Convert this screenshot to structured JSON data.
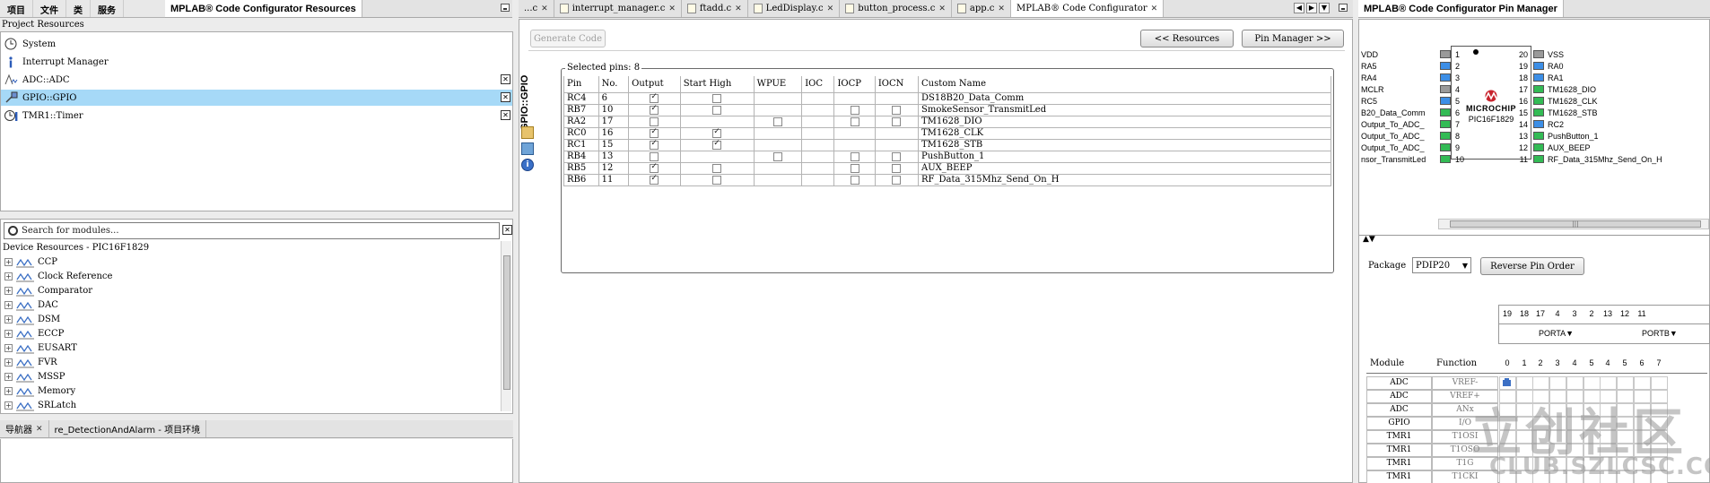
{
  "menu": [
    "项目",
    "文件",
    "类",
    "服务"
  ],
  "left_top": {
    "tab": "MPLAB® Code Configurator Resources",
    "section": "Project Resources",
    "items": [
      {
        "label": "System",
        "icon": "clock-icon"
      },
      {
        "label": "Interrupt Manager",
        "icon": "info-icon"
      },
      {
        "label": "ADC::ADC",
        "icon": "adc-icon"
      },
      {
        "label": "GPIO::GPIO",
        "icon": "pin-icon"
      },
      {
        "label": "TMR1::Timer",
        "icon": "timer-icon"
      }
    ]
  },
  "left_mid": {
    "search_placeholder": "Search for modules...",
    "device_title": "Device Resources - PIC16F1829",
    "items": [
      "CCP",
      "Clock Reference",
      "Comparator",
      "DAC",
      "DSM",
      "ECCP",
      "EUSART",
      "FVR",
      "MSSP",
      "Memory",
      "SRLatch"
    ]
  },
  "left_bottom": {
    "tab1": "导航器",
    "tab2": "re_DetectionAndAlarm - 项目环境"
  },
  "editor_tabs": [
    "...c",
    "interrupt_manager.c",
    "ftadd.c",
    "LedDisplay.c",
    "button_process.c",
    "app.c",
    "MPLAB® Code Configurator"
  ],
  "center": {
    "generate_label": "Generate Code",
    "resources_label": "<< Resources",
    "pin_manager_label": "Pin Manager >>",
    "side_title": "GPIO::GPIO",
    "selected_pins": "Selected pins: 8",
    "columns": [
      "Pin",
      "No.",
      "Output",
      "Start High",
      "WPUE",
      "IOC",
      "IOCP",
      "IOCN",
      "Custom Name"
    ],
    "rows": [
      {
        "pin": "RC4",
        "no": "6",
        "output": true,
        "start_high": false,
        "wpue": null,
        "iocp": null,
        "iocn": null,
        "name": "DS18B20_Data_Comm"
      },
      {
        "pin": "RB7",
        "no": "10",
        "output": true,
        "start_high": false,
        "wpue": null,
        "iocp": false,
        "iocn": false,
        "name": "SmokeSensor_TransmitLed"
      },
      {
        "pin": "RA2",
        "no": "17",
        "output": false,
        "start_high": null,
        "wpue": false,
        "iocp": false,
        "iocn": false,
        "name": "TM1628_DIO"
      },
      {
        "pin": "RC0",
        "no": "16",
        "output": true,
        "start_high": true,
        "wpue": null,
        "iocp": null,
        "iocn": null,
        "name": "TM1628_CLK"
      },
      {
        "pin": "RC1",
        "no": "15",
        "output": true,
        "start_high": true,
        "wpue": null,
        "iocp": null,
        "iocn": null,
        "name": "TM1628_STB"
      },
      {
        "pin": "RB4",
        "no": "13",
        "output": false,
        "start_high": null,
        "wpue": false,
        "iocp": false,
        "iocn": false,
        "name": "PushButton_1"
      },
      {
        "pin": "RB5",
        "no": "12",
        "output": true,
        "start_high": false,
        "wpue": null,
        "iocp": false,
        "iocn": false,
        "name": "AUX_BEEP"
      },
      {
        "pin": "RB6",
        "no": "11",
        "output": true,
        "start_high": false,
        "wpue": null,
        "iocp": false,
        "iocn": false,
        "name": "RF_Data_315Mhz_Send_On_H"
      }
    ]
  },
  "right": {
    "tab": "MPLAB® Code Configurator Pin Manager",
    "chip_brand": "MICROCHIP",
    "chip_name": "PIC16F1829",
    "left_pins": [
      {
        "label": "VDD",
        "num": "1",
        "color": "#9a9a9a"
      },
      {
        "label": "RA5",
        "num": "2",
        "color": "#3c8ee6"
      },
      {
        "label": "RA4",
        "num": "3",
        "color": "#3c8ee6"
      },
      {
        "label": "MCLR",
        "num": "4",
        "color": "#9a9a9a"
      },
      {
        "label": "RC5",
        "num": "5",
        "color": "#3c8ee6"
      },
      {
        "label": "B20_Data_Comm",
        "num": "6",
        "color": "#33bb55"
      },
      {
        "label": "_Output_To_ADC",
        "num": "7",
        "color": "#33bb55"
      },
      {
        "label": "_Output_To_ADC",
        "num": "8",
        "color": "#33bb55"
      },
      {
        "label": "_Output_To_ADC",
        "num": "9",
        "color": "#33bb55"
      },
      {
        "label": "nsor_TransmitLed",
        "num": "10",
        "color": "#33bb55"
      }
    ],
    "right_pins": [
      {
        "label": "VSS",
        "num": "20",
        "color": "#9a9a9a"
      },
      {
        "label": "RA0",
        "num": "19",
        "color": "#3c8ee6"
      },
      {
        "label": "RA1",
        "num": "18",
        "color": "#3c8ee6"
      },
      {
        "label": "TM1628_DIO",
        "num": "17",
        "color": "#33bb55"
      },
      {
        "label": "TM1628_CLK",
        "num": "16",
        "color": "#33bb55"
      },
      {
        "label": "TM1628_STB",
        "num": "15",
        "color": "#33bb55"
      },
      {
        "label": "RC2",
        "num": "14",
        "color": "#3c8ee6"
      },
      {
        "label": "PushButton_1",
        "num": "13",
        "color": "#33bb55"
      },
      {
        "label": "AUX_BEEP",
        "num": "12",
        "color": "#33bb55"
      },
      {
        "label": "RF_Data_315Mhz_Send_On_H",
        "num": "11",
        "color": "#33bb55"
      }
    ],
    "package_label": "Package",
    "package_value": "PDIP20",
    "reverse_label": "Reverse Pin Order",
    "pin_numbers": [
      "19",
      "18",
      "17",
      "4",
      "3",
      "2",
      "13",
      "12",
      "11"
    ],
    "port_a": "PORTA▼",
    "port_b": "PORTB▼",
    "bits": [
      "0",
      "1",
      "2",
      "3",
      "4",
      "5",
      "4",
      "5",
      "6",
      "7"
    ],
    "module_header": "Module",
    "function_header": "Function",
    "modules": [
      {
        "m": "ADC",
        "f": "VREF-"
      },
      {
        "m": "ADC",
        "f": "VREF+"
      },
      {
        "m": "ADC",
        "f": "ANx"
      },
      {
        "m": "GPIO",
        "f": "I/O"
      },
      {
        "m": "TMR1",
        "f": "T1OSI"
      },
      {
        "m": "TMR1",
        "f": "T1OSO"
      },
      {
        "m": "TMR1",
        "f": "T1G"
      },
      {
        "m": "TMR1",
        "f": "T1CKI"
      }
    ]
  },
  "watermark": {
    "text": "立创社区",
    "sub": "CLUB.SZLCSC.COM"
  }
}
